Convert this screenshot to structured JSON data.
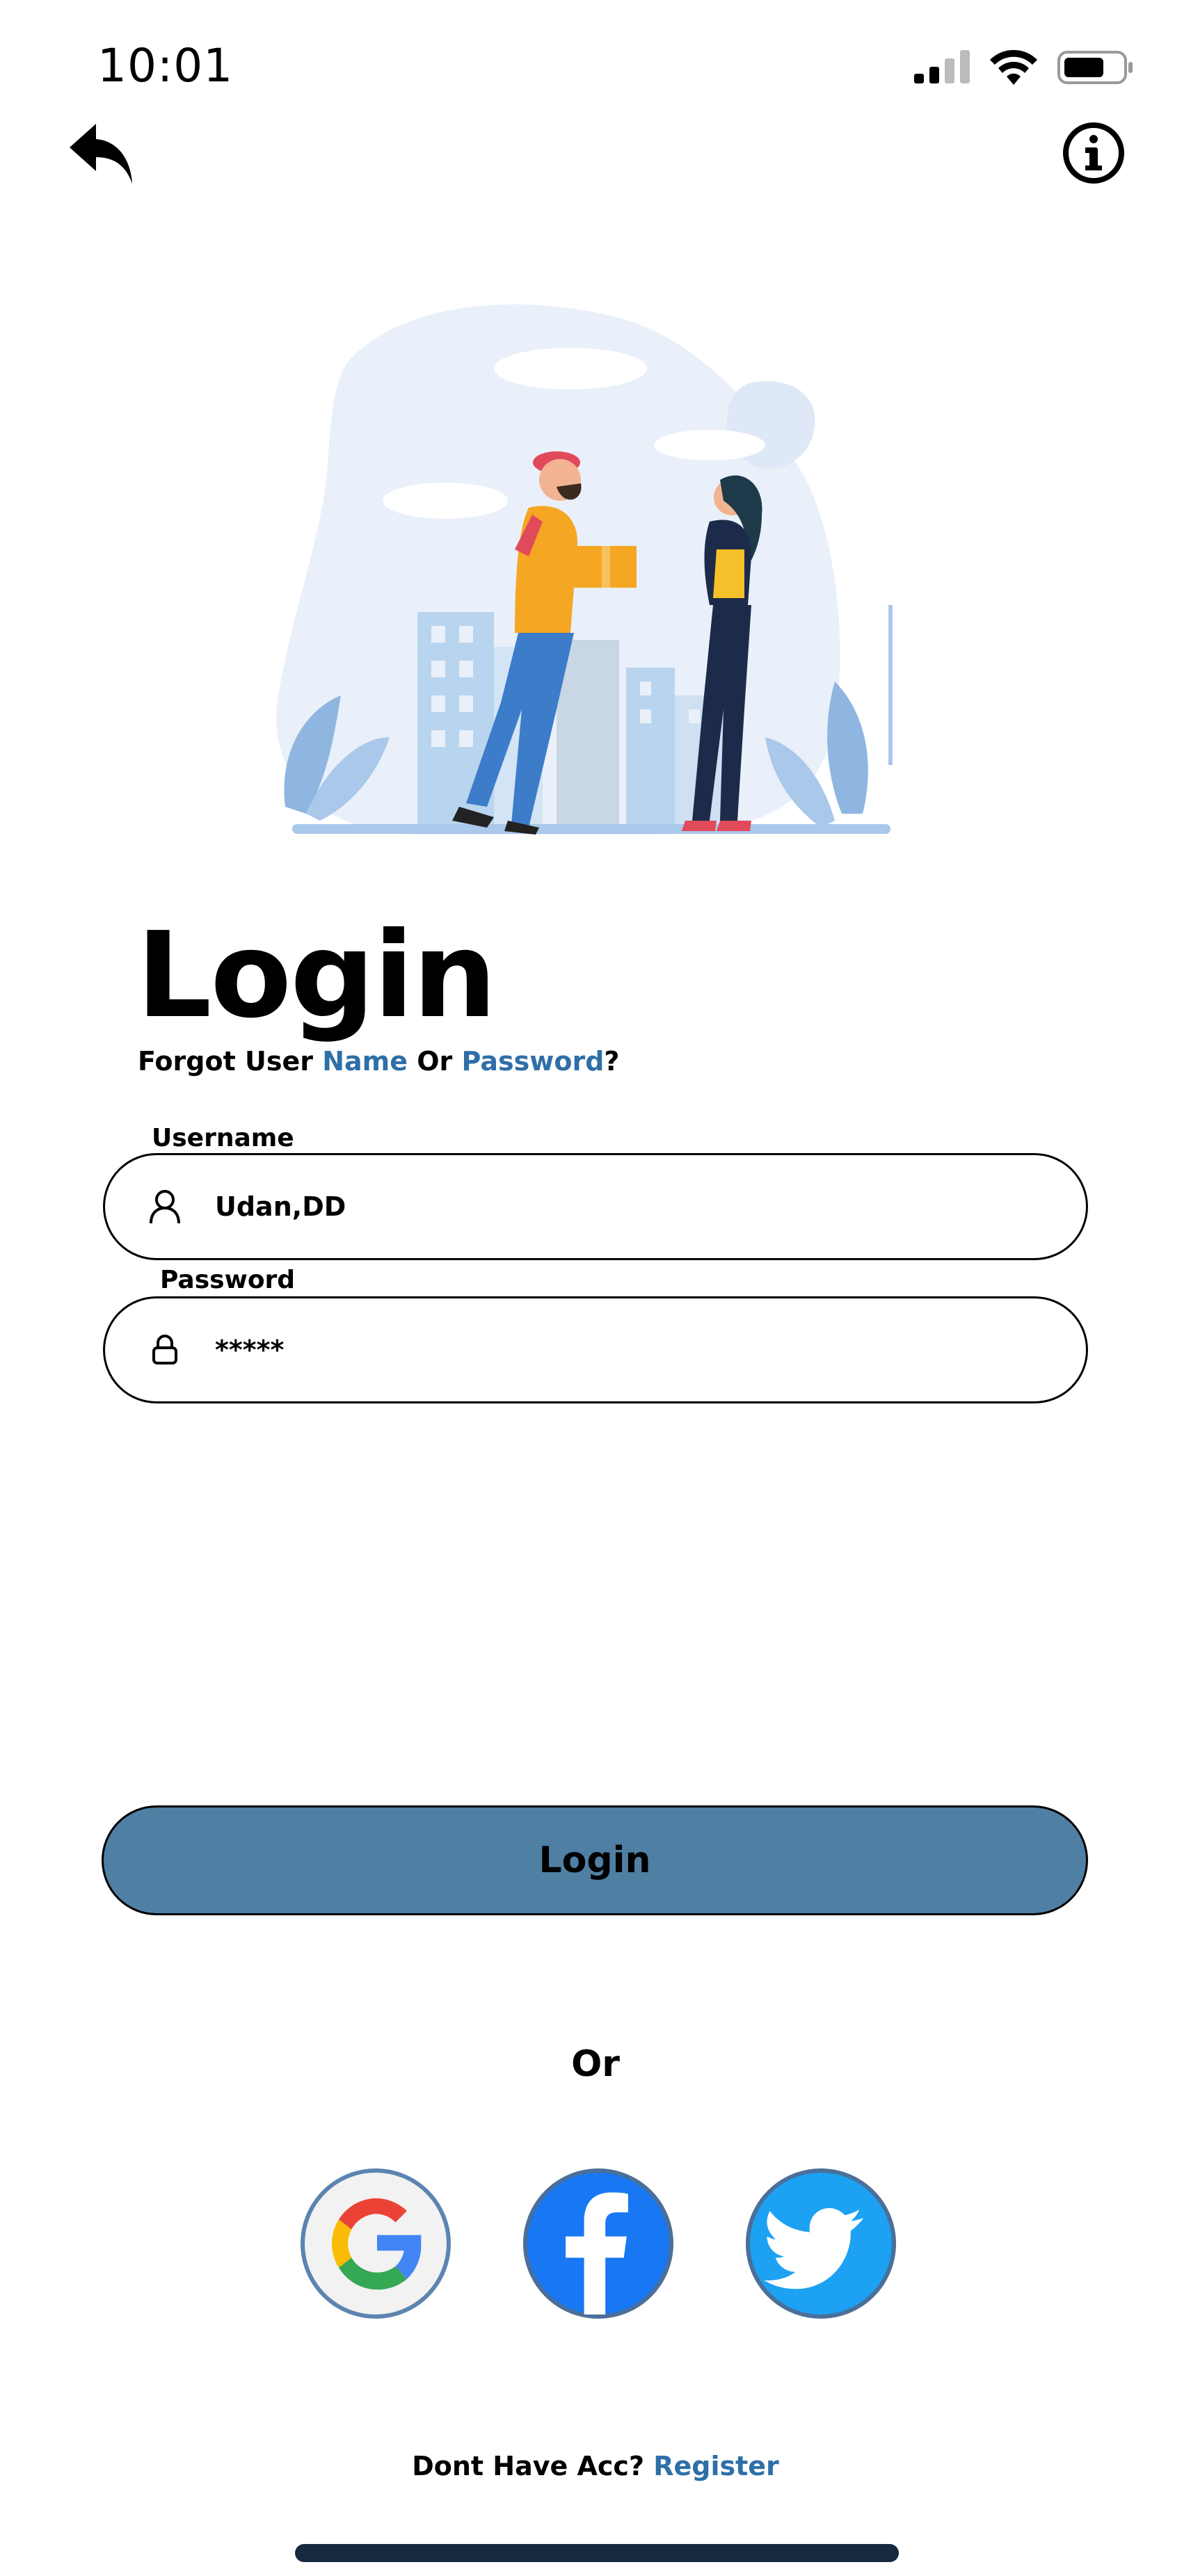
{
  "status_bar": {
    "time": "10:01"
  },
  "header": {
    "back_icon": "back-arrow-icon",
    "info_icon": "info-icon"
  },
  "login": {
    "title": "Login",
    "forgot_prefix": "Forgot User ",
    "forgot_name_link": "Name",
    "forgot_or": " Or ",
    "forgot_password_link": "Password",
    "forgot_suffix": "?"
  },
  "form": {
    "username_label": "Username",
    "username_value": "Udan,DD",
    "password_label": "Password",
    "password_value": "*****"
  },
  "actions": {
    "login_button": "Login",
    "or_text": "Or"
  },
  "social": [
    "google",
    "facebook",
    "twitter"
  ],
  "footer": {
    "no_account_text": "Dont Have Acc? ",
    "register_link": "Register"
  },
  "colors": {
    "accent": "#507fa4",
    "link": "#2f6fa8",
    "facebook": "#1877f2",
    "twitter": "#1da1f2"
  }
}
